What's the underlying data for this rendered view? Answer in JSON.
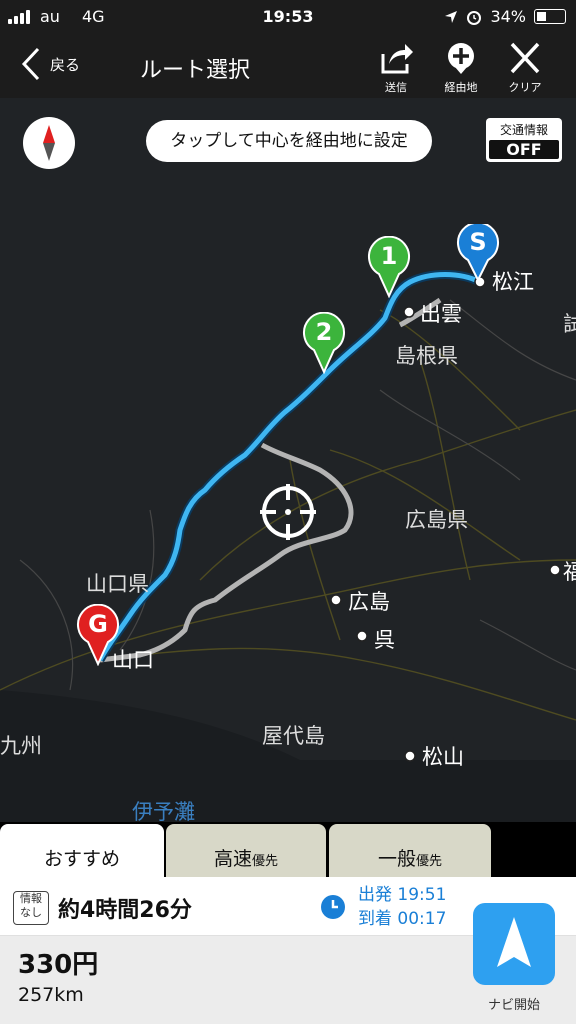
{
  "status": {
    "carrier": "au",
    "network": "4G",
    "time": "19:53",
    "battery": "34%"
  },
  "nav": {
    "back_label": "戻る",
    "title": "ルート選択",
    "send_label": "送信",
    "waypoint_label": "経由地",
    "clear_label": "クリア"
  },
  "map": {
    "tap_hint": "タップして中心を経由地に設定",
    "traffic_label": "交通情報",
    "traffic_value": "OFF",
    "markers": {
      "start": "S",
      "goal": "G",
      "wp1": "1",
      "wp2": "2"
    },
    "labels": {
      "matsue": "松江",
      "izumo": "出雲",
      "shimane": "島根県",
      "hiroshima_pref": "広島県",
      "yamaguchi_pref": "山口県",
      "yamaguchi": "山口",
      "hiroshima": "広島",
      "kure": "呉",
      "yashirojima": "屋代島",
      "matsuyama": "松山",
      "kyushu": "九州",
      "iyonada": "伊予灘",
      "fuku": "福",
      "right_edge": "試"
    },
    "route_color": "#3fb6f2",
    "alt_route_color": "#b4b4b4"
  },
  "tabs": [
    {
      "label": "おすすめ",
      "suffix": ""
    },
    {
      "label": "高速",
      "suffix": "優先"
    },
    {
      "label": "一般",
      "suffix": "優先"
    }
  ],
  "route": {
    "info_badge": "情報なし",
    "info_line1": "情報",
    "info_line2": "なし",
    "duration": "約4時間26分",
    "depart_label": "出発",
    "depart_time": "19:51",
    "arrive_label": "到着",
    "arrive_time": "00:17",
    "fare": "330円",
    "distance": "257km",
    "navi_label": "ナビ開始"
  }
}
